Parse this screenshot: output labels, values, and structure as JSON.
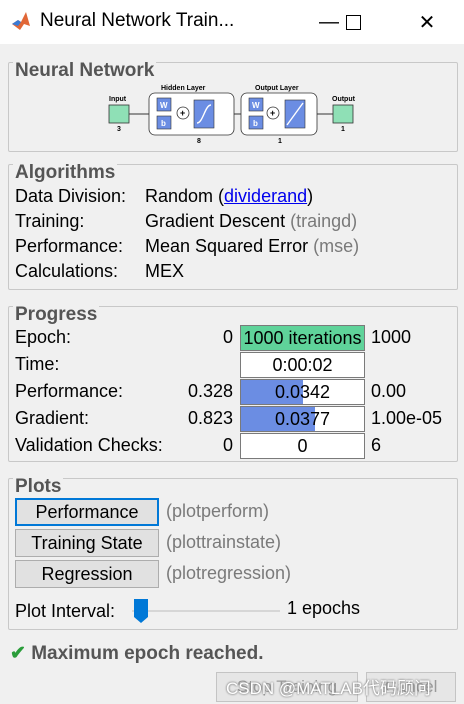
{
  "window": {
    "title": "Neural Network Train..."
  },
  "network": {
    "panel_title": "Neural Network",
    "input_label": "Input",
    "input_size": "3",
    "hidden_label": "Hidden Layer",
    "hidden_size": "8",
    "output_layer_label": "Output Layer",
    "output_layer_size": "1",
    "output_label": "Output",
    "output_size": "1",
    "w": "W",
    "b": "b"
  },
  "algorithms": {
    "panel_title": "Algorithms",
    "rows": [
      {
        "label": "Data Division:",
        "value": "Random",
        "paren_open": " (",
        "link": "dividerand",
        "paren_close": ")"
      },
      {
        "label": "Training:",
        "value": "Gradient Descent",
        "fn": "(traingd)"
      },
      {
        "label": "Performance:",
        "value": "Mean Squared Error",
        "fn": "(mse)"
      },
      {
        "label": "Calculations:",
        "value": "MEX"
      }
    ]
  },
  "progress": {
    "panel_title": "Progress",
    "rows": [
      {
        "label": "Epoch:",
        "min": "0",
        "value": "1000 iterations",
        "max": "1000",
        "fill": 1.0,
        "color": "#5fd39a"
      },
      {
        "label": "Time:",
        "min": "",
        "value": "0:00:02",
        "max": "",
        "fill": 0,
        "color": "#6b8de3"
      },
      {
        "label": "Performance:",
        "min": "0.328",
        "value": "0.0342",
        "max": "0.00",
        "fill": 0.5,
        "color": "#6b8de3"
      },
      {
        "label": "Gradient:",
        "min": "0.823",
        "value": "0.0377",
        "max": "1.00e-05",
        "fill": 0.6,
        "color": "#6b8de3"
      },
      {
        "label": "Validation Checks:",
        "min": "0",
        "value": "0",
        "max": "6",
        "fill": 0,
        "color": "#6b8de3"
      }
    ]
  },
  "plots": {
    "panel_title": "Plots",
    "buttons": [
      {
        "label": "Performance",
        "fn": "(plotperform)"
      },
      {
        "label": "Training State",
        "fn": "(plottrainstate)"
      },
      {
        "label": "Regression",
        "fn": "(plotregression)"
      }
    ],
    "interval_label": "Plot Interval:",
    "interval_value": "1 epochs",
    "interval_fraction": 0.0
  },
  "status": {
    "text": "Maximum epoch reached."
  },
  "footer": {
    "stop_training": "Stop Training",
    "cancel": "Cancel",
    "watermark": "CSDN @MATLAB代码顾问"
  }
}
